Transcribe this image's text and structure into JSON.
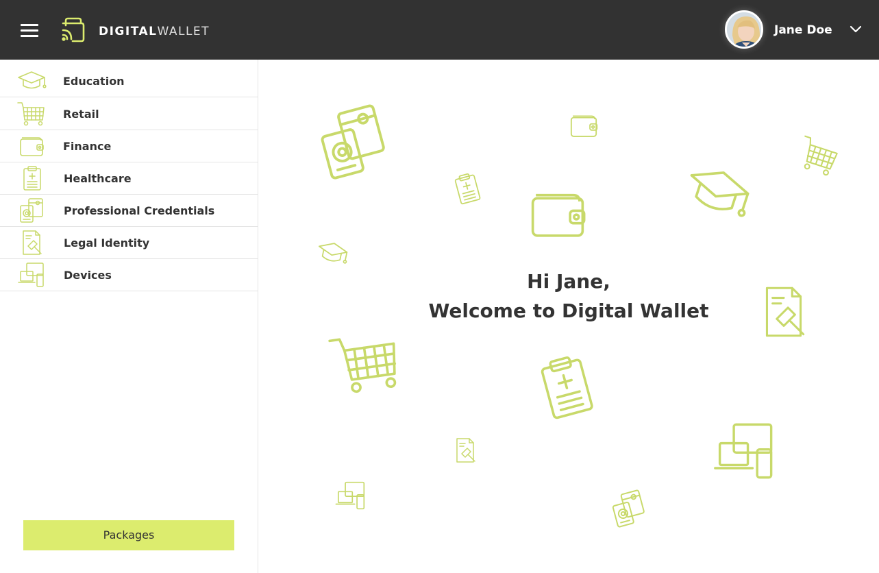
{
  "header": {
    "brand_bold": "DIGITAL",
    "brand_light": "WALLET",
    "user_name": "Jane Doe"
  },
  "sidebar": {
    "items": [
      {
        "label": "Education",
        "icon": "graduation-cap-icon"
      },
      {
        "label": "Retail",
        "icon": "shopping-cart-icon"
      },
      {
        "label": "Finance",
        "icon": "wallet-icon"
      },
      {
        "label": "Healthcare",
        "icon": "clipboard-medical-icon"
      },
      {
        "label": "Professional Credentials",
        "icon": "credentials-icon"
      },
      {
        "label": "Legal Identity",
        "icon": "gavel-document-icon"
      },
      {
        "label": "Devices",
        "icon": "devices-icon"
      }
    ],
    "packages_label": "Packages"
  },
  "main": {
    "greeting_line1": "Hi Jane,",
    "greeting_line2": "Welcome to Digital Wallet"
  },
  "colors": {
    "accent": "#dcec6e",
    "icon_stroke": "#d3e37a",
    "topbar_bg": "#323232"
  }
}
